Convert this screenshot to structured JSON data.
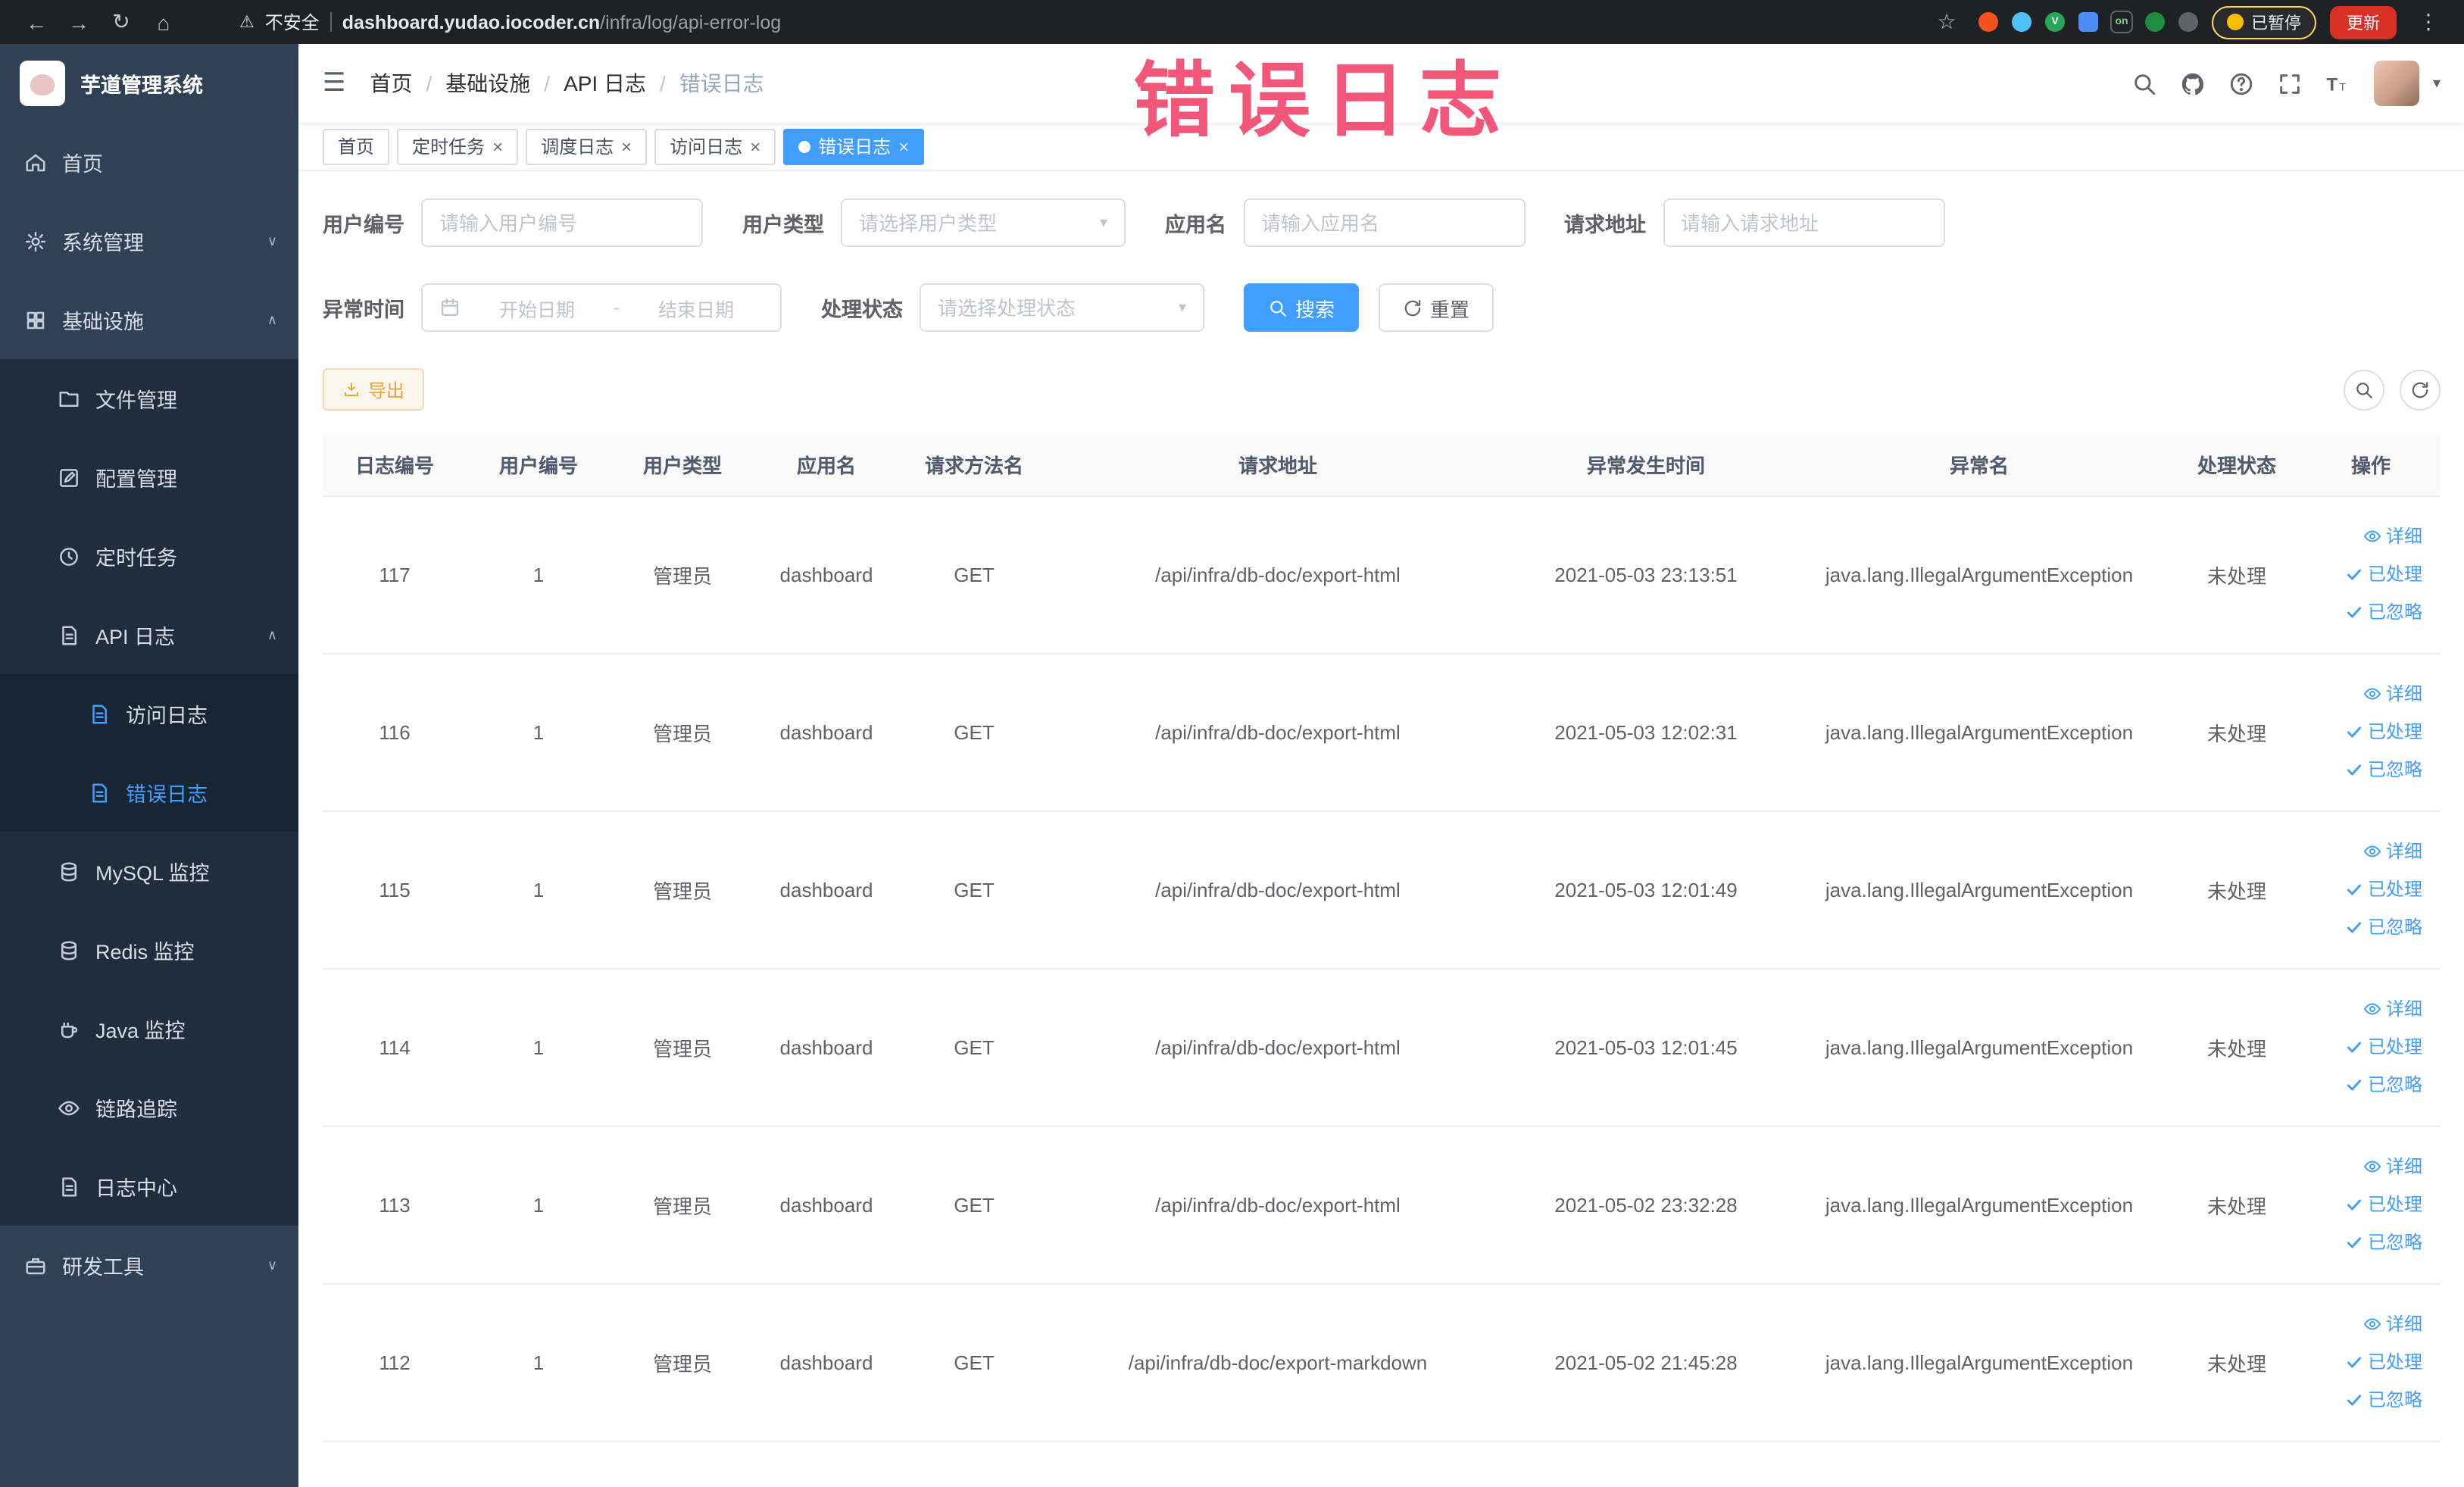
{
  "icons": {
    "back": "←",
    "forward": "→",
    "reload": "↻",
    "home_glyph": "⌂",
    "warning": "⚠",
    "star": "☆",
    "more": "⋮",
    "hamburger": "☰",
    "caret_down": "▾",
    "chevron_down": "∨",
    "chevron_up": "∧",
    "close": "×",
    "breadcrumb_sep": "/"
  },
  "browser": {
    "security_label": "不安全",
    "url_domain": "dashboard.yudao.iocoder.cn",
    "url_path": "/infra/log/api-error-log",
    "paused_badge": "已暂停",
    "update_button": "更新",
    "extensions": [
      {
        "name": "extension-icon-1",
        "color": "#f4511e",
        "shape": "circle"
      },
      {
        "name": "extension-icon-2",
        "color": "#4fc3f7",
        "shape": "circle"
      },
      {
        "name": "extension-icon-3",
        "color": "#26a65b",
        "shape": "circle",
        "text": "V"
      },
      {
        "name": "extension-icon-4",
        "color": "#4e8cf9",
        "shape": "square"
      },
      {
        "name": "extension-icon-5",
        "color": "#202124",
        "shape": "square",
        "text": "on",
        "text_color": "#81c995",
        "border": "#5f6368"
      },
      {
        "name": "extension-icon-6",
        "color": "#1e8e3e",
        "shape": "circle"
      },
      {
        "name": "extension-icon-7",
        "color": "#5f6368",
        "shape": "circle"
      }
    ]
  },
  "annotation": {
    "text": "错误日志"
  },
  "sidebar": {
    "logo_title": "芋道管理系统",
    "menu": [
      {
        "id": "home",
        "label": "首页",
        "icon": "home",
        "level": 1
      },
      {
        "id": "system",
        "label": "系统管理",
        "icon": "gear",
        "level": 1,
        "chevron": "down"
      },
      {
        "id": "infra",
        "label": "基础设施",
        "icon": "grid",
        "level": 1,
        "chevron": "up"
      },
      {
        "id": "file",
        "label": "文件管理",
        "icon": "folder",
        "level": 2
      },
      {
        "id": "config",
        "label": "配置管理",
        "icon": "edit",
        "level": 2
      },
      {
        "id": "job",
        "label": "定时任务",
        "icon": "clock",
        "level": 2
      },
      {
        "id": "api-log",
        "label": "API 日志",
        "icon": "doc",
        "level": 2,
        "chevron": "up"
      },
      {
        "id": "access-log",
        "label": "访问日志",
        "icon": "doc",
        "level": 3,
        "accent": true
      },
      {
        "id": "error-log",
        "label": "错误日志",
        "icon": "doc",
        "level": 3,
        "accent": true,
        "active": true
      },
      {
        "id": "mysql",
        "label": "MySQL 监控",
        "icon": "db",
        "level": 2
      },
      {
        "id": "redis",
        "label": "Redis 监控",
        "icon": "db",
        "level": 2
      },
      {
        "id": "java",
        "label": "Java 监控",
        "icon": "coffee",
        "level": 2
      },
      {
        "id": "trace",
        "label": "链路追踪",
        "icon": "eye",
        "level": 2
      },
      {
        "id": "log-center",
        "label": "日志中心",
        "icon": "doc",
        "level": 2
      },
      {
        "id": "devtools",
        "label": "研发工具",
        "icon": "toolbox",
        "level": 1,
        "chevron": "down"
      }
    ]
  },
  "navbar": {
    "breadcrumb": [
      {
        "label": "首页"
      },
      {
        "label": "基础设施"
      },
      {
        "label": "API 日志"
      },
      {
        "label": "错误日志",
        "current": true
      }
    ]
  },
  "tabs": [
    {
      "label": "首页",
      "closable": false,
      "active": false
    },
    {
      "label": "定时任务",
      "closable": true,
      "active": false
    },
    {
      "label": "调度日志",
      "closable": true,
      "active": false
    },
    {
      "label": "访问日志",
      "closable": true,
      "active": false
    },
    {
      "label": "错误日志",
      "closable": true,
      "active": true
    }
  ],
  "filters": {
    "user_id": {
      "label": "用户编号",
      "placeholder": "请输入用户编号"
    },
    "user_type": {
      "label": "用户类型",
      "placeholder": "请选择用户类型"
    },
    "app_name": {
      "label": "应用名",
      "placeholder": "请输入应用名"
    },
    "request_url": {
      "label": "请求地址",
      "placeholder": "请输入请求地址"
    },
    "exception_time": {
      "label": "异常时间",
      "start_placeholder": "开始日期",
      "separator": "-",
      "end_placeholder": "结束日期"
    },
    "process_status": {
      "label": "处理状态",
      "placeholder": "请选择处理状态"
    },
    "search_button": "搜索",
    "reset_button": "重置"
  },
  "toolbar": {
    "export_label": "导出"
  },
  "table": {
    "columns": [
      {
        "key": "id",
        "label": "日志编号"
      },
      {
        "key": "user_id",
        "label": "用户编号"
      },
      {
        "key": "user_type",
        "label": "用户类型"
      },
      {
        "key": "app",
        "label": "应用名"
      },
      {
        "key": "method",
        "label": "请求方法名"
      },
      {
        "key": "url",
        "label": "请求地址"
      },
      {
        "key": "time",
        "label": "异常发生时间"
      },
      {
        "key": "exception",
        "label": "异常名"
      },
      {
        "key": "status",
        "label": "处理状态"
      },
      {
        "key": "actions",
        "label": "操作"
      }
    ],
    "action_labels": {
      "detail": "详细",
      "processed": "已处理",
      "ignored": "已忽略"
    },
    "rows": [
      {
        "id": "117",
        "user_id": "1",
        "user_type": "管理员",
        "app": "dashboard",
        "method": "GET",
        "url": "/api/infra/db-doc/export-html",
        "time": "2021-05-03 23:13:51",
        "exception": "java.lang.IllegalArgumentException",
        "status": "未处理"
      },
      {
        "id": "116",
        "user_id": "1",
        "user_type": "管理员",
        "app": "dashboard",
        "method": "GET",
        "url": "/api/infra/db-doc/export-html",
        "time": "2021-05-03 12:02:31",
        "exception": "java.lang.IllegalArgumentException",
        "status": "未处理"
      },
      {
        "id": "115",
        "user_id": "1",
        "user_type": "管理员",
        "app": "dashboard",
        "method": "GET",
        "url": "/api/infra/db-doc/export-html",
        "time": "2021-05-03 12:01:49",
        "exception": "java.lang.IllegalArgumentException",
        "status": "未处理"
      },
      {
        "id": "114",
        "user_id": "1",
        "user_type": "管理员",
        "app": "dashboard",
        "method": "GET",
        "url": "/api/infra/db-doc/export-html",
        "time": "2021-05-03 12:01:45",
        "exception": "java.lang.IllegalArgumentException",
        "status": "未处理"
      },
      {
        "id": "113",
        "user_id": "1",
        "user_type": "管理员",
        "app": "dashboard",
        "method": "GET",
        "url": "/api/infra/db-doc/export-html",
        "time": "2021-05-02 23:32:28",
        "exception": "java.lang.IllegalArgumentException",
        "status": "未处理"
      },
      {
        "id": "112",
        "user_id": "1",
        "user_type": "管理员",
        "app": "dashboard",
        "method": "GET",
        "url": "/api/infra/db-doc/export-markdown",
        "time": "2021-05-02 21:45:28",
        "exception": "java.lang.IllegalArgumentException",
        "status": "未处理"
      }
    ]
  }
}
